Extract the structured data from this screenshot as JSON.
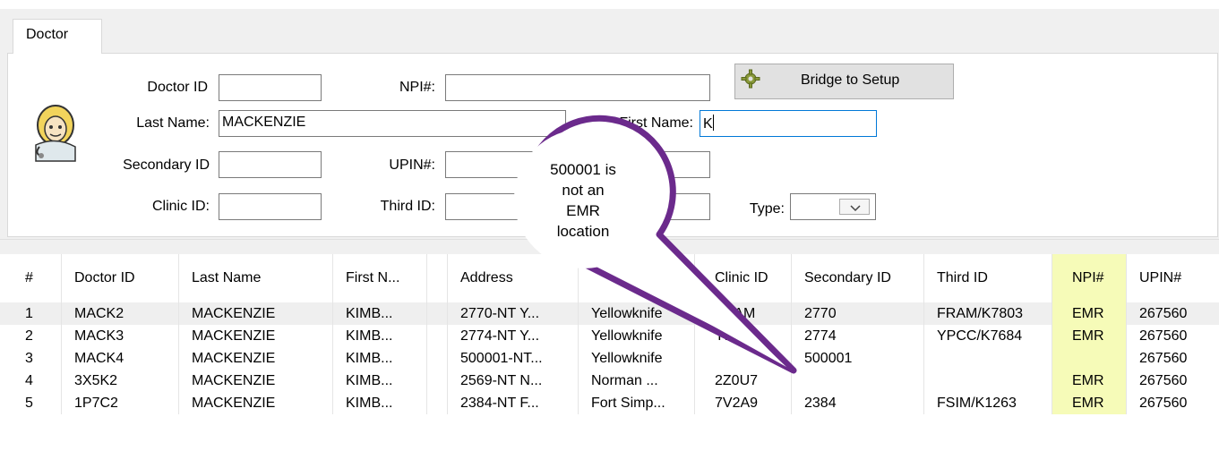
{
  "tab": {
    "label": "Doctor"
  },
  "form": {
    "doctor_id": {
      "label": "Doctor ID",
      "value": ""
    },
    "npi": {
      "label": "NPI#:",
      "value": ""
    },
    "last_name": {
      "label": "Last Name:",
      "value": "MACKENZIE"
    },
    "first_name": {
      "label": "First Name:",
      "value": "K"
    },
    "secondary_id": {
      "label": "Secondary ID",
      "value": ""
    },
    "upin": {
      "label": "UPIN#:",
      "value": ""
    },
    "clinic_id": {
      "label": "Clinic ID:",
      "value": ""
    },
    "third_id": {
      "label": "Third ID:",
      "value": ""
    },
    "type": {
      "label": "Type:",
      "value": ""
    },
    "bridge_button": "Bridge to Setup"
  },
  "callout": {
    "line1": "500001 is",
    "line2": "not an",
    "line3": "EMR",
    "line4": "location"
  },
  "table": {
    "columns": [
      "#",
      "Doctor ID",
      "Last Name",
      "First N...",
      "",
      "Address",
      "",
      "Clinic ID",
      "Secondary ID",
      "Third ID",
      "NPI#",
      "UPIN#"
    ],
    "rows": [
      [
        "1",
        "MACK2",
        "MACKENZIE",
        "KIMB...",
        "",
        "2770-NT Y...",
        "Yellowknife",
        "FRAM",
        "2770",
        "FRAM/K7803",
        "EMR",
        "267560"
      ],
      [
        "2",
        "MACK3",
        "MACKENZIE",
        "KIMB...",
        "",
        "2774-NT Y...",
        "Yellowknife",
        "YPCC",
        "2774",
        "YPCC/K7684",
        "EMR",
        "267560"
      ],
      [
        "3",
        "MACK4",
        "MACKENZIE",
        "KIMB...",
        "",
        "500001-NT...",
        "Yellowknife",
        "",
        "500001",
        "",
        "",
        "267560"
      ],
      [
        "4",
        "3X5K2",
        "MACKENZIE",
        "KIMB...",
        "",
        "2569-NT N...",
        "Norman ...",
        "2Z0U7",
        "",
        "",
        "EMR",
        "267560"
      ],
      [
        "5",
        "1P7C2",
        "MACKENZIE",
        "KIMB...",
        "",
        "2384-NT F...",
        "Fort Simp...",
        "7V2A9",
        "2384",
        "FSIM/K1263",
        "EMR",
        "267560"
      ]
    ]
  },
  "colors": {
    "npi_highlight": "#f6fbb8",
    "callout_border": "#6b2a8c",
    "focus_border": "#0078d7"
  }
}
